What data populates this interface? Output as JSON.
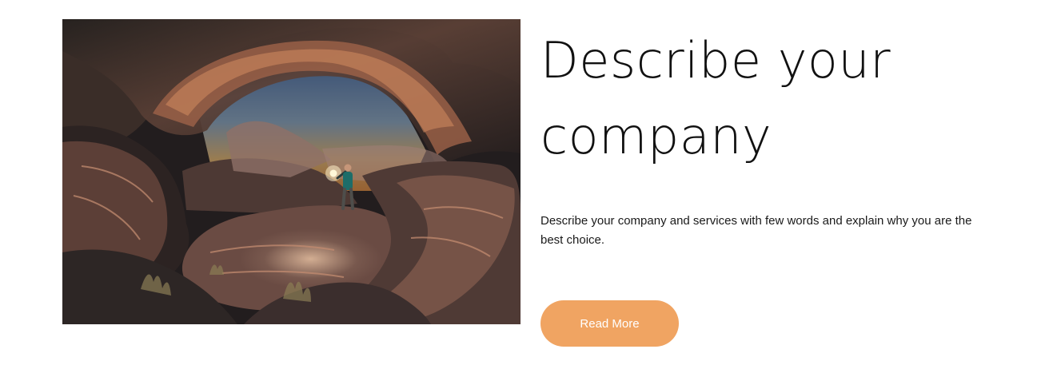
{
  "hero": {
    "image_icon": "landscape-photo-icon"
  },
  "content": {
    "title": "Describe your company",
    "description": "Describe your company and services with few words and explain why you are the best choice.",
    "button_label": "Read More"
  },
  "colors": {
    "accent": "#f0a462",
    "text": "#111111",
    "background": "#ffffff"
  }
}
